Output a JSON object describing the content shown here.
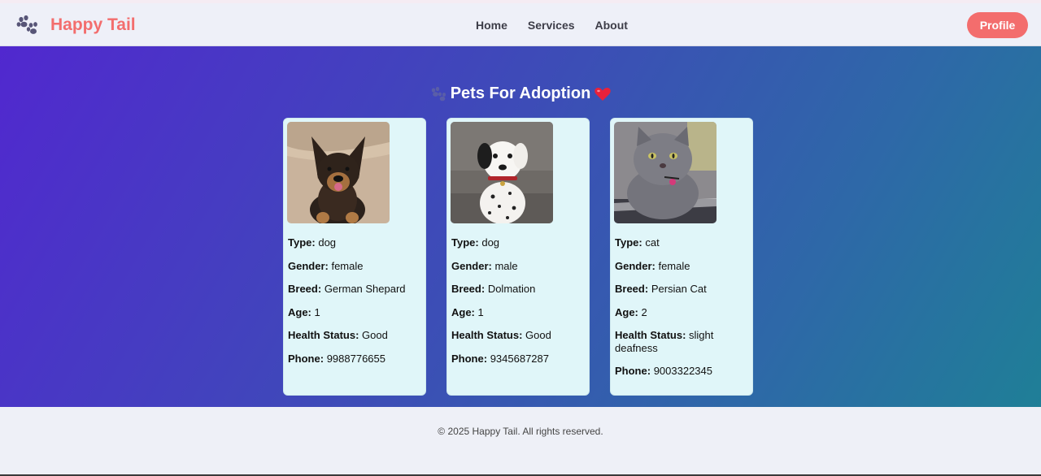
{
  "brand": {
    "name": "Happy Tail",
    "icon": "paw-icon"
  },
  "nav": {
    "items": [
      "Home",
      "Services",
      "About"
    ]
  },
  "header": {
    "profile_label": "Profile"
  },
  "main": {
    "title": "Pets For Adoption",
    "title_icons": [
      "paw-icon",
      "heart-icon"
    ]
  },
  "labels": {
    "type": "Type:",
    "gender": "Gender:",
    "breed": "Breed:",
    "age": "Age:",
    "health": "Health Status:",
    "phone": "Phone:"
  },
  "pets": [
    {
      "type": "dog",
      "gender": "female",
      "breed": "German Shepard",
      "age": "1",
      "health": "Good",
      "phone": "9988776655",
      "photo": "german-shepherd-puppy-photo"
    },
    {
      "type": "dog",
      "gender": "male",
      "breed": "Dolmation",
      "age": "1",
      "health": "Good",
      "phone": "9345687287",
      "photo": "dalmatian-puppy-photo"
    },
    {
      "type": "cat",
      "gender": "female",
      "breed": "Persian Cat",
      "age": "2",
      "health": "slight deafness",
      "phone": "9003322345",
      "photo": "persian-cat-photo"
    }
  ],
  "footer": {
    "copyright": "© 2025 Happy Tail. All rights reserved."
  },
  "colors": {
    "accent": "#f36d6d",
    "card_bg": "#e0f6f9",
    "gradient_start": "#5128cf",
    "gradient_end": "#1f7f97"
  }
}
